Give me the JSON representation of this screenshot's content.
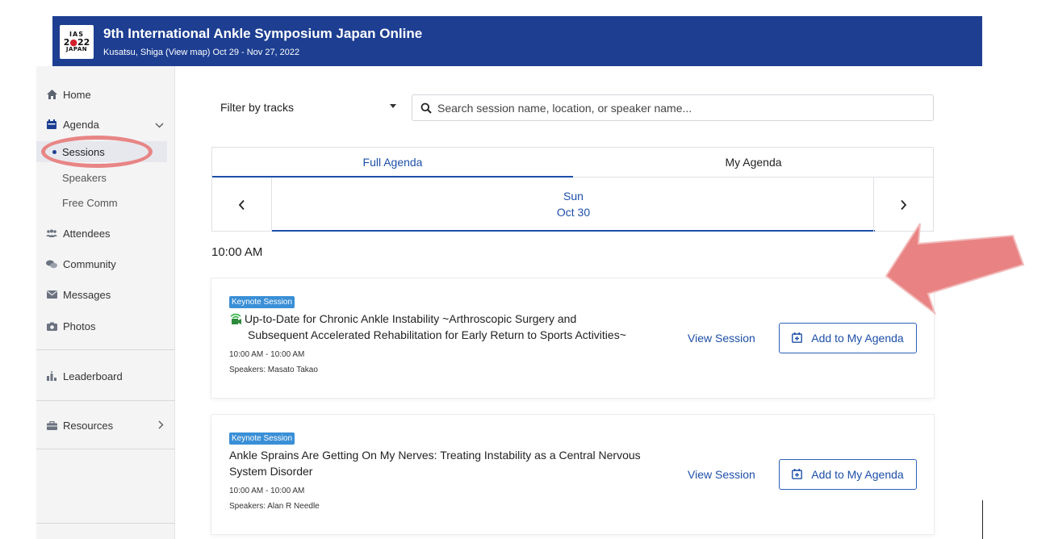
{
  "header": {
    "logo": {
      "line1": "IAS",
      "line2a": "2",
      "line2b": "●",
      "line2c": "22",
      "line3": "JAPAN"
    },
    "title": "9th International Ankle Symposium Japan Online",
    "subtitle": "Kusatsu, Shiga (View map)   Oct 29 - Nov 27, 2022"
  },
  "sidebar": {
    "home": "Home",
    "agenda": "Agenda",
    "sessions": "Sessions",
    "speakers": "Speakers",
    "free_comm": "Free Comm",
    "attendees": "Attendees",
    "community": "Community",
    "messages": "Messages",
    "photos": "Photos",
    "leaderboard": "Leaderboard",
    "resources": "Resources"
  },
  "filter": {
    "label": "Filter by tracks"
  },
  "search": {
    "placeholder": "Search session name, location, or speaker name..."
  },
  "tabs": {
    "full": "Full Agenda",
    "my": "My Agenda"
  },
  "day": {
    "weekday": "Sun",
    "date": "Oct 30",
    "prev": "‹",
    "next": "›"
  },
  "time_heading": "10:00 AM",
  "sessions": [
    {
      "badge": "Keynote Session",
      "title_line1": "Up-to-Date for Chronic Ankle Instability ~Arthroscopic Surgery and",
      "title_line2": "Subsequent Accelerated Rehabilitation for Early Return to Sports Activities~",
      "time": "10:00 AM - 10:00 AM",
      "speakers": "Speakers: Masato Takao",
      "view": "View Session",
      "add": "Add to My Agenda"
    },
    {
      "badge": "Keynote Session",
      "title_line1": "Ankle Sprains Are Getting On My Nerves: Treating Instability as a Central Nervous",
      "title_line2": "System Disorder",
      "time": "10:00 AM - 10:00 AM",
      "speakers": "Speakers: Alan R Needle",
      "view": "View Session",
      "add": "Add to My Agenda"
    }
  ],
  "colors": {
    "brand": "#1d3e91",
    "accent": "#1d4fa8",
    "badge": "#3a8fd6",
    "annotation": "#e88585"
  }
}
